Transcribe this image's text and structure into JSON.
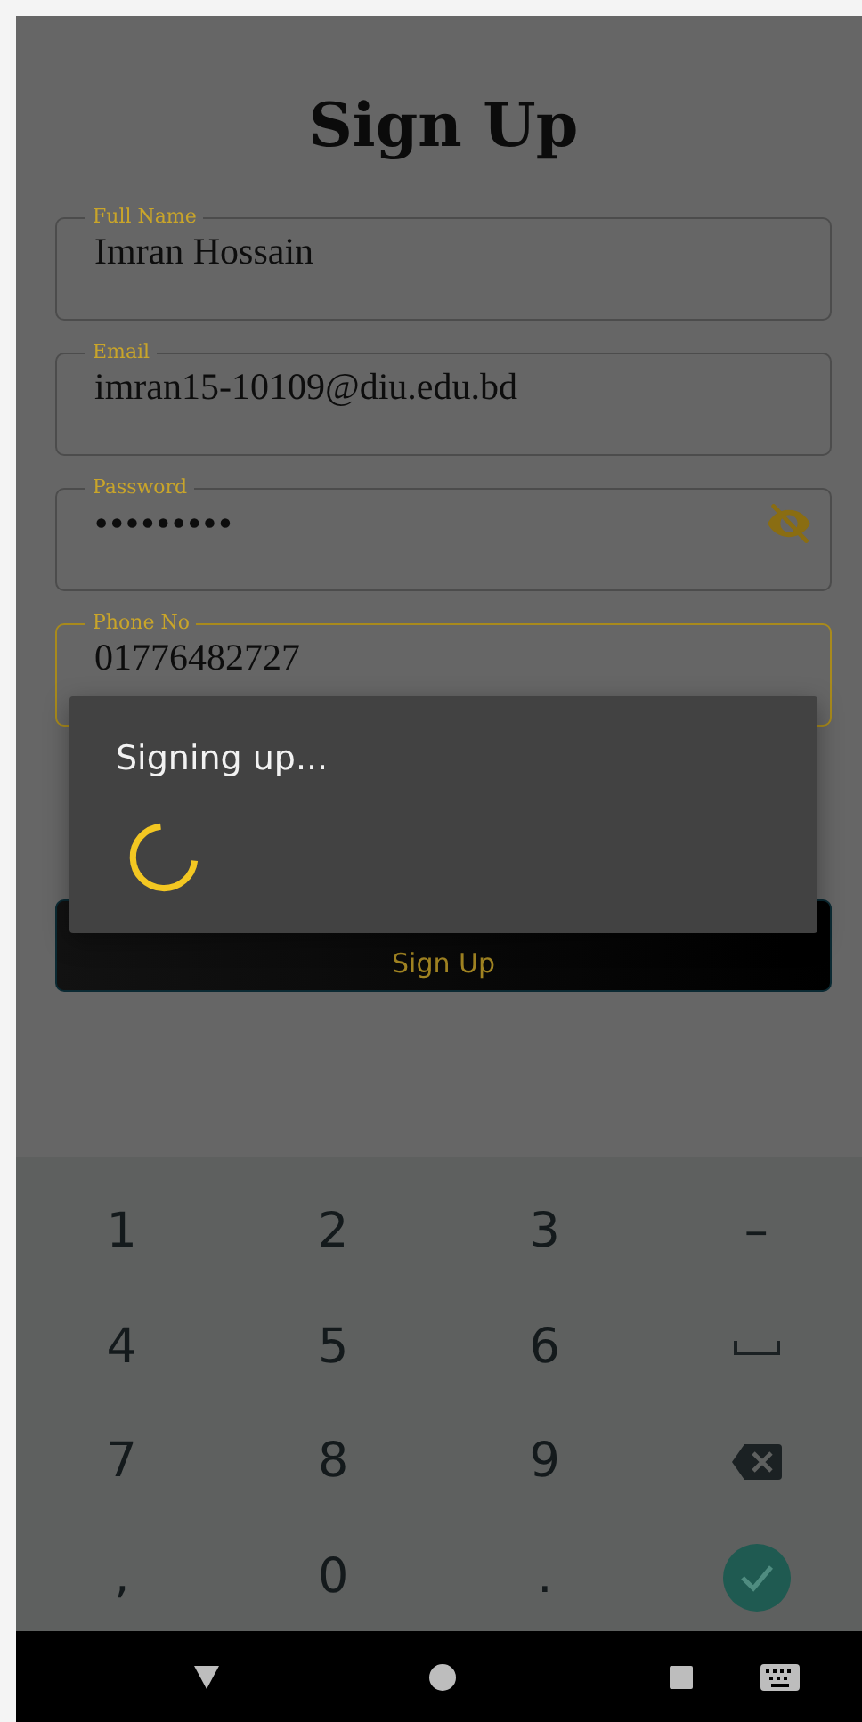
{
  "title": "Sign Up",
  "fields": [
    {
      "label": "Full Name",
      "value": "Imran Hossain",
      "focused": false,
      "kind": "text"
    },
    {
      "label": "Email",
      "value": "imran15-10109@diu.edu.bd",
      "focused": false,
      "kind": "text"
    },
    {
      "label": "Password",
      "value": "•••••••••",
      "focused": false,
      "kind": "password"
    },
    {
      "label": "Phone No",
      "value": "01776482727",
      "focused": true,
      "kind": "text"
    }
  ],
  "submit_button": "Sign Up",
  "dialog": {
    "message": "Signing up..."
  },
  "keyboard": [
    {
      "kind": "char",
      "label": "1"
    },
    {
      "kind": "char",
      "label": "2"
    },
    {
      "kind": "char",
      "label": "3"
    },
    {
      "kind": "char",
      "label": "–"
    },
    {
      "kind": "char",
      "label": "4"
    },
    {
      "kind": "char",
      "label": "5"
    },
    {
      "kind": "char",
      "label": "6"
    },
    {
      "kind": "space"
    },
    {
      "kind": "char",
      "label": "7"
    },
    {
      "kind": "char",
      "label": "8"
    },
    {
      "kind": "char",
      "label": "9"
    },
    {
      "kind": "backspace"
    },
    {
      "kind": "char",
      "label": ","
    },
    {
      "kind": "char",
      "label": "0"
    },
    {
      "kind": "char",
      "label": "."
    },
    {
      "kind": "done"
    }
  ]
}
